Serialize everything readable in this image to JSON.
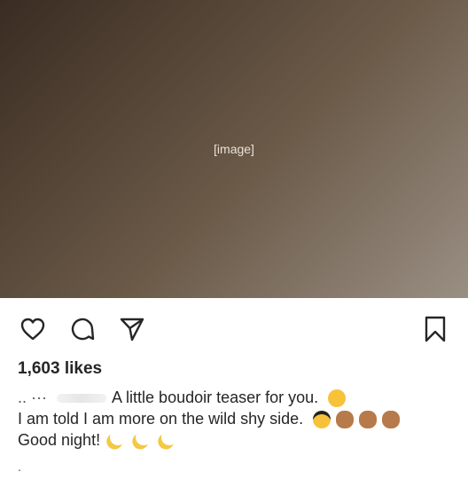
{
  "post": {
    "image_placeholder": "[image]",
    "likes_text": "1,603 likes",
    "caption": {
      "line1_prefix": ".. ···",
      "line1_text": "A little boudoir teaser for you.",
      "line2_text": "I am told I am more on the wild shy side.",
      "line3_text": "Good night!",
      "trailing": "."
    }
  },
  "icons": {
    "like": "heart-icon",
    "comment": "comment-icon",
    "share": "send-icon",
    "save": "bookmark-icon"
  }
}
